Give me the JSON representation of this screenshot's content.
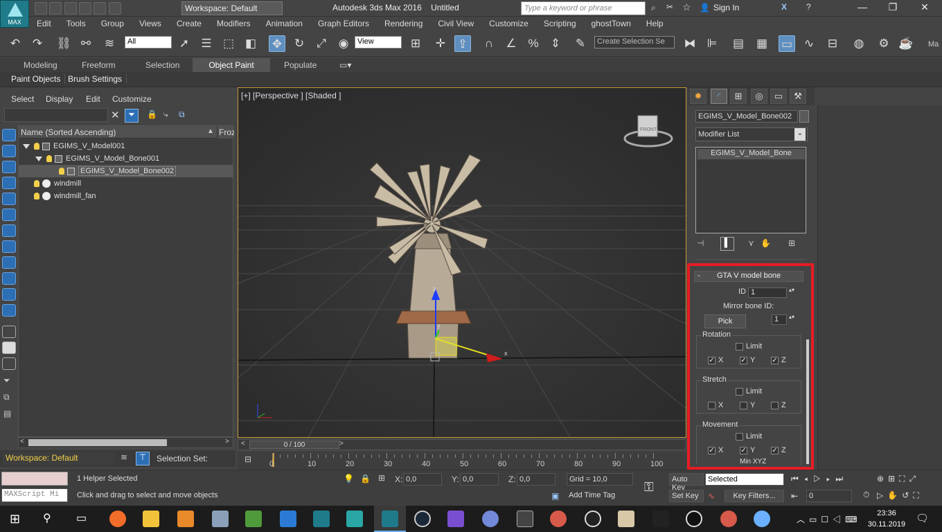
{
  "titlebar": {
    "logo_label": "MAX",
    "workspace": "Workspace: Default",
    "app_title": "Autodesk 3ds Max 2016",
    "doc_title": "Untitled",
    "search_placeholder": "Type a keyword or phrase",
    "sign_in": "Sign In"
  },
  "menu": [
    "Edit",
    "Tools",
    "Group",
    "Views",
    "Create",
    "Modifiers",
    "Animation",
    "Graph Editors",
    "Rendering",
    "Civil View",
    "Customize",
    "Scripting",
    "ghostTown",
    "Help"
  ],
  "toolbar": {
    "filter_value": "All",
    "refcoord_value": "View",
    "selection_set_placeholder": "Create Selection Se"
  },
  "ribbon": {
    "tabs": [
      "Modeling",
      "Freeform",
      "Selection",
      "Object Paint",
      "Populate"
    ],
    "active_tab": "Object Paint",
    "sub_items": [
      "Paint Objects",
      "Brush Settings"
    ]
  },
  "scene_explorer": {
    "menu": [
      "Select",
      "Display",
      "Edit",
      "Customize"
    ],
    "col_name": "Name (Sorted Ascending)",
    "col_frozen": "Froz",
    "items": [
      {
        "name": "EGIMS_V_Model001"
      },
      {
        "name": "EGIMS_V_Model_Bone001"
      },
      {
        "name": "EGIMS_V_Model_Bone002"
      },
      {
        "name": "windmill"
      },
      {
        "name": "windmill_fan"
      }
    ],
    "workspace": "Workspace: Default",
    "selection_set": "Selection Set:"
  },
  "viewport": {
    "label": "[+] [Perspective ] [Shaded ]",
    "gizmo_x": "x",
    "gizmo_y": "y",
    "gizmo_z": "z",
    "viewcube_label": "FRONT"
  },
  "timeline": {
    "frame": "0 / 100",
    "ticks": [
      "0",
      "10",
      "20",
      "30",
      "40",
      "50",
      "60",
      "70",
      "80",
      "90",
      "100"
    ]
  },
  "command_panel": {
    "object_name": "EGIMS_V_Model_Bone002",
    "modifier_list": "Modifier List",
    "stack_item": "EGIMS_V_Model_Bone",
    "rollout_title": "GTA V model bone",
    "rollout_collapse": "-",
    "id_label": "ID",
    "id_value": "1",
    "mirror_label": "Mirror bone ID:",
    "pick_label": "Pick",
    "mirror_value": "1",
    "groups": [
      {
        "title": "Rotation",
        "limit_label": "Limit",
        "limit_checked": false,
        "x": true,
        "y": true,
        "z": true
      },
      {
        "title": "Stretch",
        "limit_label": "Limit",
        "limit_checked": false,
        "x": false,
        "y": false,
        "z": false
      },
      {
        "title": "Movement",
        "limit_label": "Limit",
        "limit_checked": false,
        "x": true,
        "y": true,
        "z": true
      }
    ],
    "axis_labels": {
      "x": "X",
      "y": "Y",
      "z": "Z"
    },
    "min_xyz": "Min XYZ"
  },
  "status": {
    "maxscript": "MAXScript Mi",
    "selected": "1 Helper Selected",
    "prompt": "Click and drag to select and move objects",
    "x_label": "X:",
    "x_value": "0,0",
    "y_label": "Y:",
    "y_value": "0,0",
    "z_label": "Z:",
    "z_value": "0,0",
    "grid": "Grid = 10,0",
    "add_time_tag": "Add Time Tag",
    "auto_key": "Auto Key",
    "set_key": "Set Key",
    "key_mode": "Selected",
    "key_filters": "Key Filters...",
    "frame_value": "0"
  },
  "taskbar": {
    "time": "23:36",
    "date": "30.11.2019"
  },
  "colors": {
    "accent_blue": "#2d6fb5",
    "highlight_red": "#e81c24",
    "viewport_border": "#c89b3c"
  }
}
